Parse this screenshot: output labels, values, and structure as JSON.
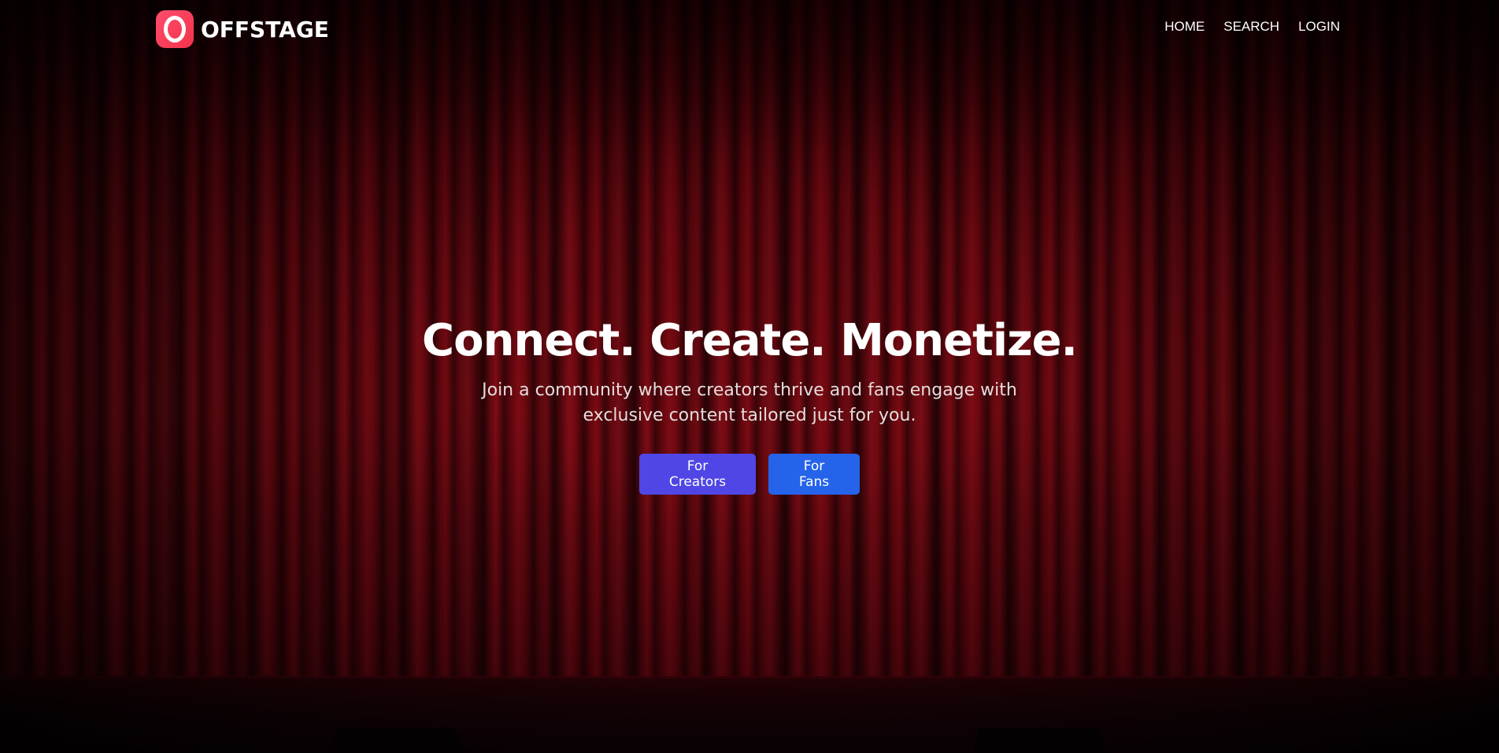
{
  "brand": {
    "name": "OFFSTAGE",
    "logo_icon": "o-ring-logo-icon",
    "logo_color": "#f2334a"
  },
  "nav": {
    "links": [
      "HOME",
      "SEARCH",
      "LOGIN"
    ]
  },
  "hero": {
    "headline": "Connect. Create. Monetize.",
    "subtitle": "Join a community where creators thrive and fans engage with exclusive content tailored just for you.",
    "buttons": {
      "creators": "For Creators",
      "fans": "For Fans"
    },
    "colors": {
      "creators_button": "#4f46e5",
      "fans_button": "#2563eb",
      "curtain": "#8a0a14"
    }
  }
}
